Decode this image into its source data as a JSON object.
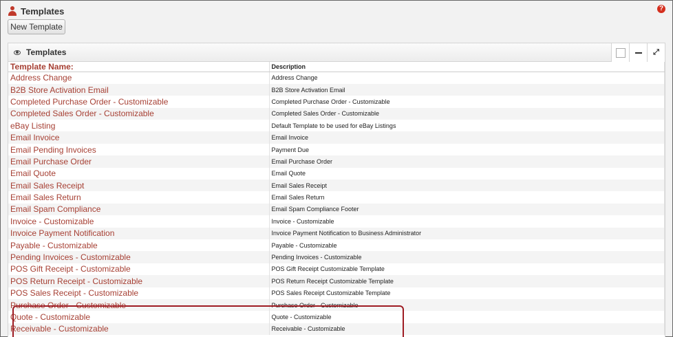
{
  "page": {
    "title": "Templates",
    "new_button_label": "New Template"
  },
  "panel": {
    "title": "Templates"
  },
  "table": {
    "columns": [
      "Template Name:",
      "Description"
    ],
    "rows": [
      {
        "name": "Address Change",
        "description": "Address Change"
      },
      {
        "name": "B2B Store Activation Email",
        "description": "B2B Store Activation Email"
      },
      {
        "name": "Completed Purchase Order - Customizable",
        "description": "Completed Purchase Order - Customizable"
      },
      {
        "name": "Completed Sales Order - Customizable",
        "description": "Completed Sales Order - Customizable"
      },
      {
        "name": "eBay Listing",
        "description": "Default Template to be used for eBay Listings"
      },
      {
        "name": "Email Invoice",
        "description": "Email Invoice"
      },
      {
        "name": "Email Pending Invoices",
        "description": "Payment Due"
      },
      {
        "name": "Email Purchase Order",
        "description": "Email Purchase Order"
      },
      {
        "name": "Email Quote",
        "description": "Email Quote"
      },
      {
        "name": "Email Sales Receipt",
        "description": "Email Sales Receipt"
      },
      {
        "name": "Email Sales Return",
        "description": "Email Sales Return"
      },
      {
        "name": "Email Spam Compliance",
        "description": "Email Spam Compliance Footer"
      },
      {
        "name": "Invoice - Customizable",
        "description": "Invoice - Customizable"
      },
      {
        "name": "Invoice Payment Notification",
        "description": "Invoice Payment Notification to Business Administrator"
      },
      {
        "name": "Payable - Customizable",
        "description": "Payable - Customizable"
      },
      {
        "name": "Pending Invoices - Customizable",
        "description": "Pending Invoices - Customizable"
      },
      {
        "name": "POS Gift Receipt - Customizable",
        "description": "POS Gift Receipt Customizable Template"
      },
      {
        "name": "POS Return Receipt - Customizable",
        "description": "POS Return Receipt Customizable Template"
      },
      {
        "name": "POS Sales Receipt - Customizable",
        "description": "POS Sales Receipt Customizable Template"
      },
      {
        "name": "Purchase Order - Customizable",
        "description": "Purchase Order - Customizable"
      },
      {
        "name": "Quote - Customizable",
        "description": "Quote - Customizable"
      },
      {
        "name": "Receivable - Customizable",
        "description": "Receivable - Customizable"
      }
    ]
  },
  "icons": {
    "header": "user-icon",
    "help": "help-icon",
    "panel": "eye-icon",
    "tools": [
      "checkbox-icon",
      "minimize-icon",
      "expand-icon"
    ]
  },
  "colors": {
    "link": "#a63f33",
    "highlight_border": "#9e1b22",
    "help": "#d42f1e"
  }
}
